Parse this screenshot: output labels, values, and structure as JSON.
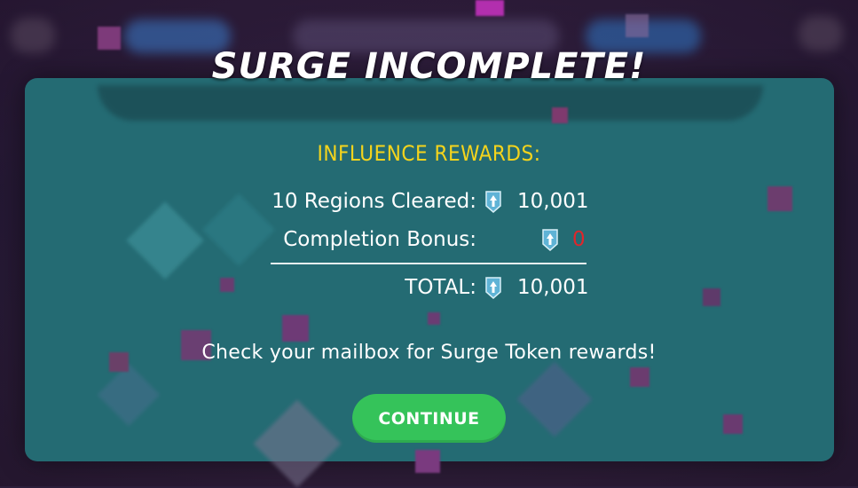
{
  "colors": {
    "title": "#ffffff",
    "rewards_header": "#f5d41c",
    "panel": "#246b73",
    "bonus_value": "#e0262b",
    "continue_button": "#35c35a"
  },
  "dialog": {
    "title": "SURGE INCOMPLETE!",
    "rewards_header": "INFLUENCE REWARDS:",
    "rows": [
      {
        "label": "10 Regions Cleared:",
        "icon": "influence-token-icon",
        "value": "10,001"
      },
      {
        "label": "Completion Bonus:",
        "icon": "influence-token-icon",
        "value": "0"
      }
    ],
    "total": {
      "label": "TOTAL:",
      "icon": "influence-token-icon",
      "value": "10,001"
    },
    "mail_message": "Check your mailbox for Surge Token rewards!",
    "continue_label": "CONTINUE"
  }
}
